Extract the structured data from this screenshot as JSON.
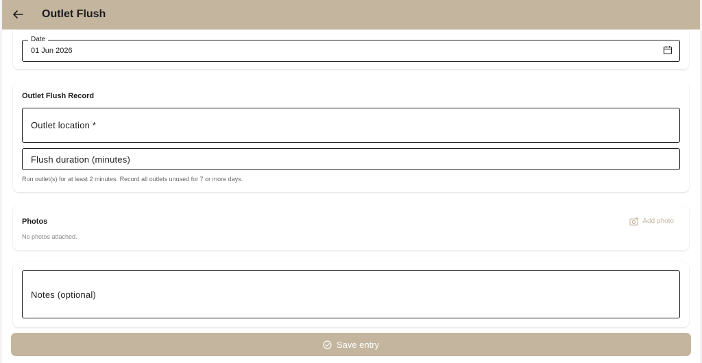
{
  "appbar": {
    "title": "Outlet Flush",
    "back_icon": "arrow-left-icon",
    "color": "#c4b59e"
  },
  "date": {
    "label": "Date",
    "value": "01 Jun 2026",
    "icon": "calendar-icon"
  },
  "record": {
    "title": "Outlet Flush Record",
    "outlet_location": {
      "placeholder": "Outlet location *"
    },
    "flush_duration": {
      "placeholder": "Flush duration (minutes)"
    },
    "helper": "Run outlet(s) for at least 2 minutes. Record all outlets unused for 7 or more days."
  },
  "photos": {
    "title": "Photos",
    "add_label": "Add photo",
    "add_icon": "add-photo-icon",
    "empty": "No photos attached."
  },
  "notes": {
    "placeholder": "Notes (optional)"
  },
  "save": {
    "label": "Save entry",
    "icon": "check-circle-icon"
  }
}
